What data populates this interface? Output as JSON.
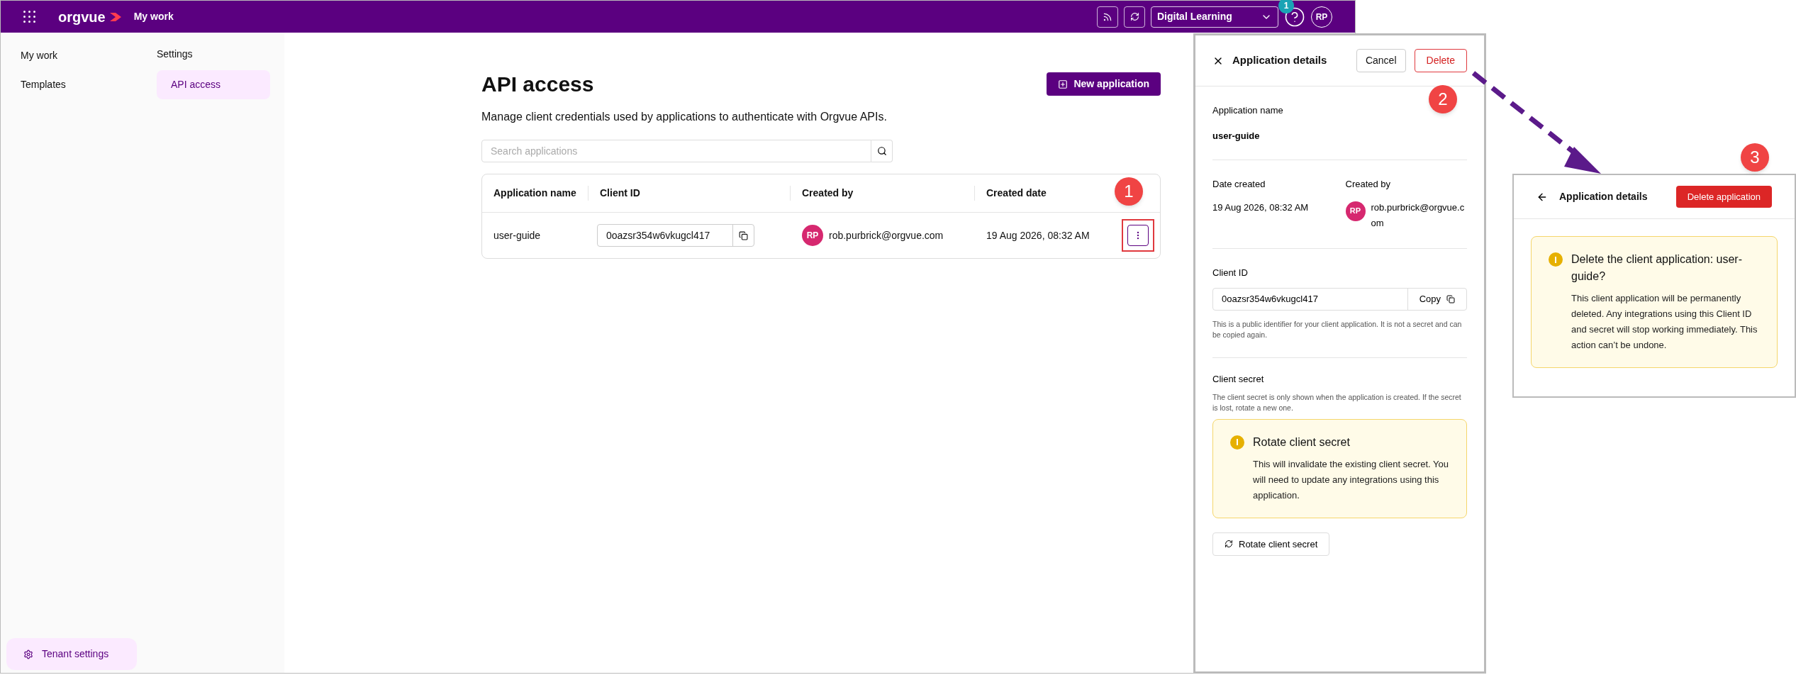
{
  "topbar": {
    "logo": "orgvue",
    "title": "My work",
    "workspace": "Digital Learning",
    "notification_count": "1",
    "avatar": "RP"
  },
  "nav": {
    "items": [
      {
        "label": "My work",
        "selected": false
      },
      {
        "label": "Templates",
        "selected": false
      }
    ],
    "footer": {
      "label": "Tenant settings",
      "selected": true
    }
  },
  "subnav": {
    "title": "Settings",
    "items": [
      {
        "label": "API access",
        "selected": true
      }
    ]
  },
  "page": {
    "title": "API access",
    "description": "Manage client credentials used by applications to authenticate with Orgvue APIs.",
    "new_button": "New application",
    "search": {
      "placeholder": "Search applications"
    },
    "table": {
      "columns": [
        "Application name",
        "Client ID",
        "Created by",
        "Created date"
      ],
      "rows": [
        {
          "name": "user-guide",
          "client_id": "0oazsr354w6vkugcl417",
          "avatar": "RP",
          "created_by": "rob.purbrick@orgvue.com",
          "created_date": "19 Aug 2026, 08:32 AM",
          "menu_highlighted": true
        }
      ]
    }
  },
  "details": {
    "title": "Application details",
    "cancel": "Cancel",
    "delete": "Delete",
    "name_label": "Application name",
    "name": "user-guide",
    "date_label": "Date created",
    "date": "19 Aug 2026, 08:32 AM",
    "created_by_label": "Created by",
    "avatar": "RP",
    "created_by": "rob.purbrick@orgvue.com",
    "client_id_label": "Client ID",
    "client_id": "0oazsr354w6vkugcl417",
    "copy": "Copy",
    "client_id_help": "This is a public identifier for your client application. It is not a secret and can be copied again.",
    "secret_label": "Client secret",
    "secret_help": "The client secret is only shown when the application is created. If the secret is lost, rotate a new one.",
    "alert_title": "Rotate client secret",
    "alert_body": "This will invalidate the existing client secret. You will need to update any integrations using this application.",
    "rotate_button": "Rotate client secret"
  },
  "confirm": {
    "title": "Application details",
    "delete_button": "Delete application",
    "alert_title": "Delete the client application: user-guide?",
    "alert_body": "This client application will be permanently deleted. Any integrations using this Client ID and secret will stop working immediately. This action can’t be undone."
  },
  "callouts": [
    {
      "number": "1"
    },
    {
      "number": "2"
    },
    {
      "number": "3"
    }
  ]
}
